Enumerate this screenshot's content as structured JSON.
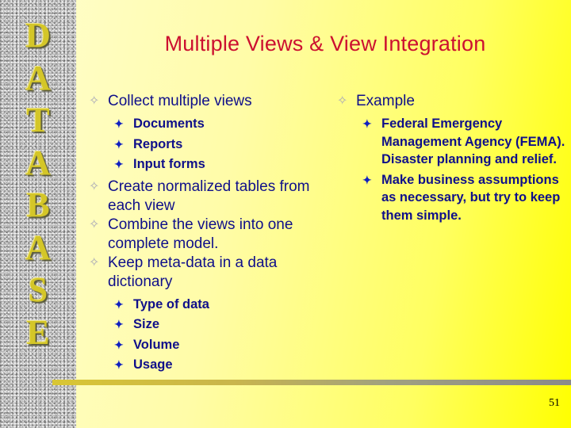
{
  "sidebar": {
    "letters": [
      "D",
      "A",
      "T",
      "A",
      "B",
      "A",
      "S",
      "E"
    ]
  },
  "slide": {
    "title": "Multiple Views & View Integration",
    "page_number": "51"
  },
  "left_column": {
    "item1": {
      "text": "Collect multiple views",
      "subitems": [
        "Documents",
        "Reports",
        "Input forms"
      ]
    },
    "item2": {
      "text": "Create normalized tables from each view"
    },
    "item3": {
      "text": "Combine the views into one complete model."
    },
    "item4": {
      "text": "Keep meta-data in a data dictionary",
      "subitems": [
        "Type of data",
        "Size",
        "Volume",
        "Usage"
      ]
    }
  },
  "right_column": {
    "item1": {
      "text": "Example",
      "subitems": [
        "Federal Emergency Management Agency (FEMA).  Disaster planning and relief.",
        "Make business assumptions as necessary, but try to keep them simple."
      ]
    }
  },
  "icons": {
    "level1_bullet": "✧",
    "level2_bullet": "✦"
  },
  "colors": {
    "title": "#cc1030",
    "body_text": "#0f0f8a",
    "sidebar_letters": "#d4c628"
  }
}
